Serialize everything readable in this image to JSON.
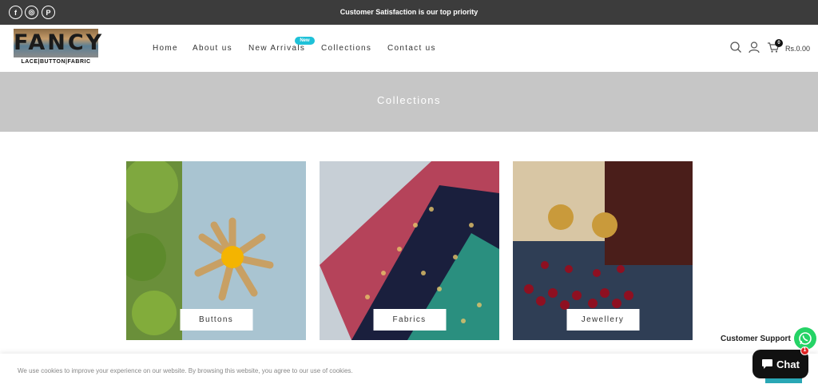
{
  "topbar": {
    "message": "Customer Satisfaction is our top priority",
    "social": [
      {
        "icon": "facebook-icon",
        "glyph": "f"
      },
      {
        "icon": "instagram-icon",
        "glyph": "◎"
      },
      {
        "icon": "pinterest-icon",
        "glyph": "P"
      }
    ]
  },
  "header": {
    "logo": {
      "title": "FANCY",
      "subtitle": "LACE|BUTTON|FABRIC"
    },
    "nav": [
      "Home",
      "About us",
      "New Arrivals",
      "Collections",
      "Contact us"
    ],
    "new_badge": "New",
    "cart": {
      "count": "0",
      "total": "Rs.0.00"
    }
  },
  "banner": {
    "title": "Collections"
  },
  "collections": [
    {
      "label": "Buttons"
    },
    {
      "label": "Fabrics"
    },
    {
      "label": "Jewellery"
    }
  ],
  "cookie": {
    "text": "We use cookies to improve your experience on our website. By browsing this website, you agree to our use of cookies."
  },
  "support": {
    "label": "Customer Support",
    "chat_label": "Chat",
    "chat_badge": "1"
  },
  "colors": {
    "topbar": "#3c3c3c",
    "banner": "#c6c6c6",
    "badge": "#1ec1d8",
    "whatsapp": "#25d366"
  }
}
